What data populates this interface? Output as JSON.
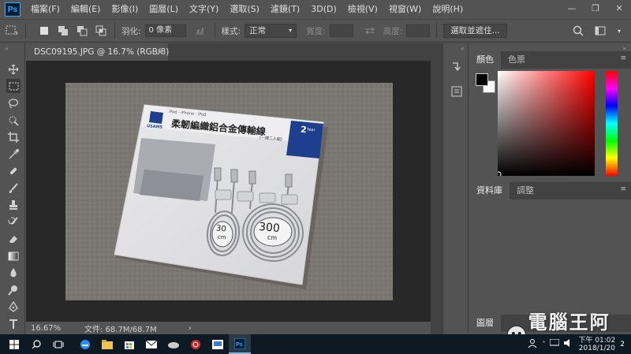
{
  "app": {
    "logo_text": "Ps"
  },
  "menu": [
    "檔案(F)",
    "編輯(E)",
    "影像(I)",
    "圖層(L)",
    "文字(Y)",
    "選取(S)",
    "濾鏡(T)",
    "3D(D)",
    "檢視(V)",
    "視窗(W)",
    "說明(H)"
  ],
  "window_controls": {
    "minimize": "—",
    "restore": "❐",
    "close": "✕"
  },
  "options": {
    "feather_label": "羽化:",
    "feather_value": "0 像素",
    "style_label": "樣式:",
    "style_value": "正常",
    "width_label": "寬度:",
    "height_label": "高度:",
    "select_mask_button": "選取並遮住..."
  },
  "document": {
    "tab_title": "DSC09195.JPG @ 16.7% (RGB/8)",
    "tab_close": "×",
    "zoom": "16.67%",
    "file_info": "文件: 68.7M/68.7M",
    "status_arrow": "›"
  },
  "photo": {
    "brand": "USAMS",
    "product_title": "柔韌編織鋁合金傳輸線",
    "subtitle": "(一線二入組)",
    "compat": "iPad · iPhone · iPod",
    "badge_number": "2",
    "badge_unit": "Year",
    "length_small": "30",
    "length_large": "300",
    "unit": "cm"
  },
  "panels": {
    "color_tabs": [
      "顏色",
      "色票"
    ],
    "library_tabs": [
      "資料庫",
      "調整"
    ],
    "layers_tab": "圖層"
  },
  "taskbar": {
    "time": "下午 01:02",
    "date": "2018/1/20",
    "notifications": "2"
  },
  "watermark": {
    "text": "電腦王阿達"
  },
  "colors": {
    "ui_bg": "#535353",
    "panel_dark": "#424242",
    "canvas_bg": "#282828",
    "taskbar": "#0e1a23",
    "ps_blue": "#31a8ff"
  }
}
